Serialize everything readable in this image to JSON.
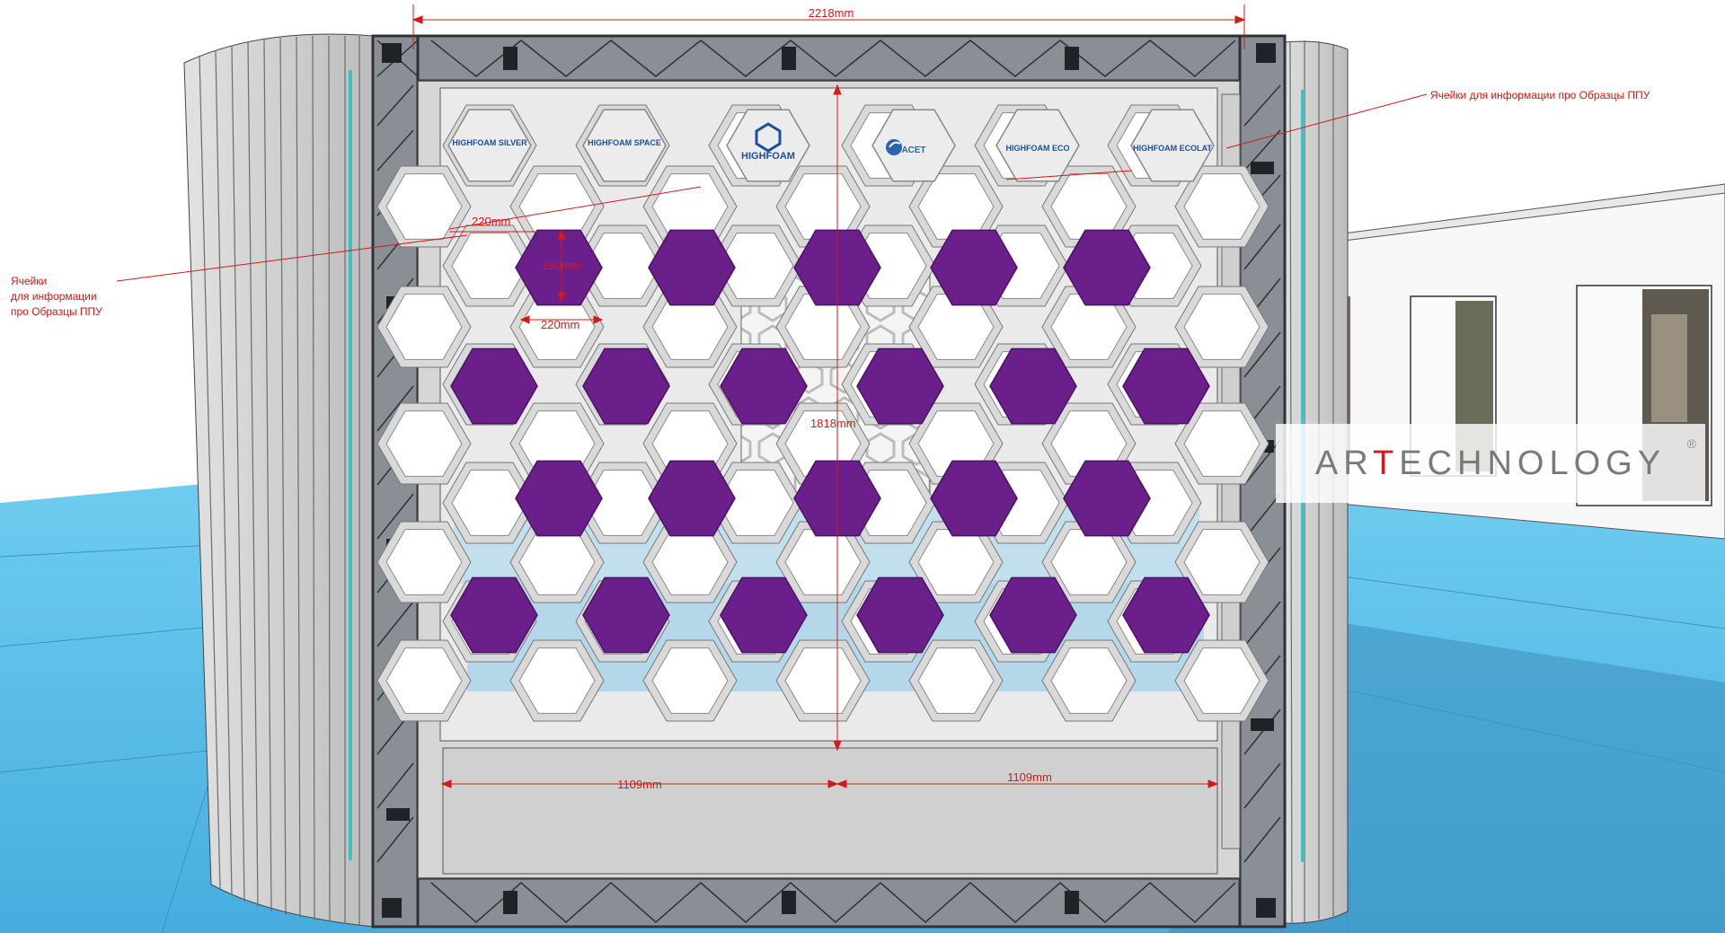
{
  "dimensions": {
    "overall_width": "2218mm",
    "height": "1818mm",
    "half_left": "1109mm",
    "half_right": "1109mm",
    "cell_width_top": "220mm",
    "cell_height": "190mm",
    "cell_width_bottom": "220mm"
  },
  "callouts": {
    "left_lines": [
      "Ячейки",
      "для информации",
      "про Образцы ППУ"
    ],
    "right": "Ячейки для информации про Образцы ППУ"
  },
  "logos": {
    "highfoam_silver": "HIGHFOAM SILVER",
    "highfoam_space": "HIGHFOAM SPACE",
    "highfoam_main": "HIGHFOAM",
    "acet": "АСЕТ",
    "highfoam_eco": "HIGHFOAM ECO",
    "highfoam_ecolat": "HIGHFOAM ECOLAT"
  },
  "brand": {
    "name": "ARTECHNOLOGY",
    "reg": "®",
    "accent_letter_color": "#d21a1a"
  },
  "colors": {
    "floor": "#5fc3ea",
    "panel": "#d9d9d9",
    "hex_fill": "#6a1f8a",
    "frame": "#3c4148",
    "dimension": "#d21a1a"
  }
}
